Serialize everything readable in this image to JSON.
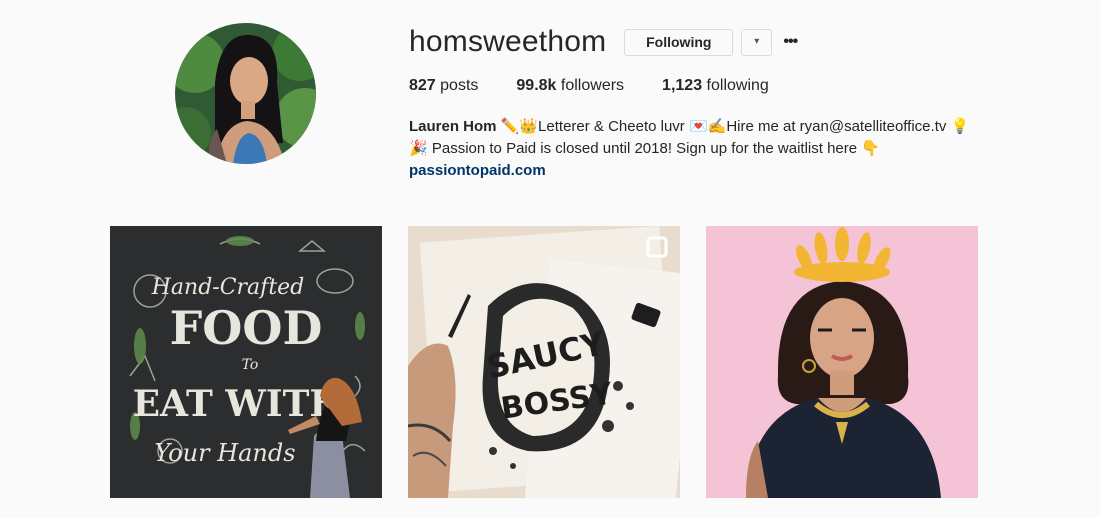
{
  "profile": {
    "username": "homsweethom",
    "following_button": "Following",
    "dropdown_icon": "▾",
    "more_icon": "•••"
  },
  "stats": {
    "posts_count": "827",
    "posts_label": "posts",
    "followers_count": "99.8k",
    "followers_label": "followers",
    "following_count": "1,123",
    "following_label": "following"
  },
  "bio": {
    "name": "Lauren Hom",
    "line1_emoji_a": "✏️👑",
    "line1_text_a": "Letterer & Cheeto luvr ",
    "line1_emoji_b": "💌✍️",
    "line1_text_b": "Hire me at ryan@satelliteoffice.tv ",
    "line1_emoji_c": "💡",
    "line2_emoji_a": "🎉",
    "line2_text": " Passion to Paid is closed until 2018! Sign up for the waitlist here ",
    "line2_emoji_b": "👇",
    "link": "passiontopaid.com"
  },
  "posts": [
    {
      "name": "chalkboard-mural",
      "words": [
        "Hand-Crafted",
        "FOOD",
        "To",
        "EAT WITH",
        "Your Hands"
      ]
    },
    {
      "name": "saucy-bossy-sketch",
      "words": [
        "SAUCY",
        "BOSSY"
      ]
    },
    {
      "name": "cheeto-crown-portrait"
    }
  ],
  "colors": {
    "link": "#003569",
    "background": "#fafafa",
    "border": "#dbdbdb",
    "chalkboard": "#2b2d2e",
    "pink": "#f4c3d6"
  }
}
